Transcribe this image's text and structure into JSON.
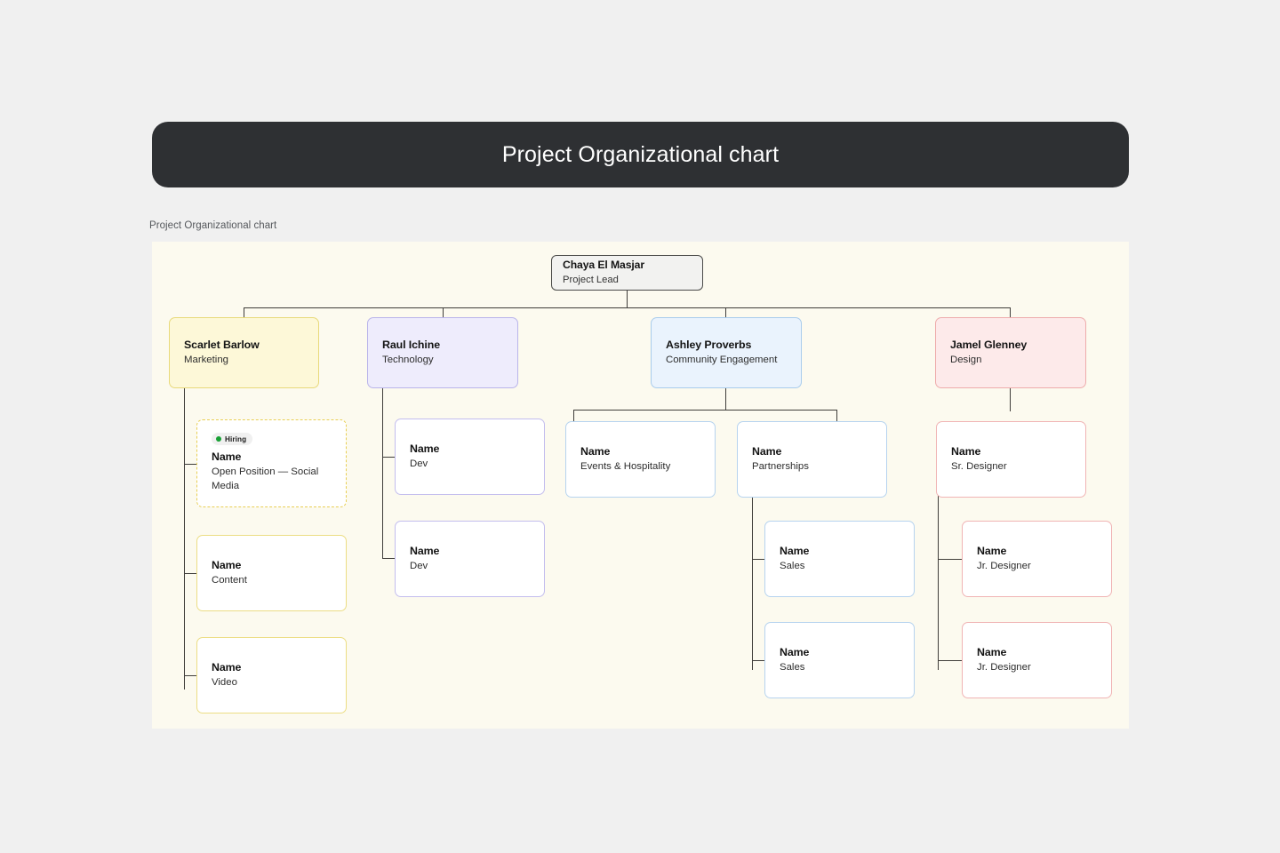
{
  "banner": {
    "title": "Project Organizational chart"
  },
  "caption": "Project Organizational chart",
  "colors": {
    "page_bg": "#f0f0f0",
    "banner_bg": "#2e3033",
    "canvas_bg": "#fcfaef",
    "connector": "#3f3d3a",
    "marketing": "#e8d97a",
    "technology": "#b9b4ea",
    "community": "#a9ccec",
    "design": "#eeacac",
    "hiring_dot": "#17a034"
  },
  "chart_data": {
    "type": "diagram",
    "title": "Project Organizational chart",
    "root": {
      "name": "Chaya El Masjar",
      "role": "Project Lead"
    },
    "departments": [
      {
        "name": "Scarlet Barlow",
        "role": "Marketing",
        "accent": "#e8d97a",
        "reports": [
          {
            "name": "Name",
            "role": "Open Position — Social Media",
            "badge": "Hiring",
            "status": "hiring"
          },
          {
            "name": "Name",
            "role": "Content"
          },
          {
            "name": "Name",
            "role": "Video"
          }
        ]
      },
      {
        "name": "Raul Ichine",
        "role": "Technology",
        "accent": "#b9b4ea",
        "reports": [
          {
            "name": "Name",
            "role": "Dev"
          },
          {
            "name": "Name",
            "role": "Dev"
          }
        ]
      },
      {
        "name": "Ashley Proverbs",
        "role": "Community Engagement",
        "accent": "#a9ccec",
        "reports": [
          {
            "name": "Name",
            "role": "Events & Hospitality"
          },
          {
            "name": "Name",
            "role": "Partnerships",
            "reports": [
              {
                "name": "Name",
                "role": "Sales"
              },
              {
                "name": "Name",
                "role": "Sales"
              }
            ]
          }
        ]
      },
      {
        "name": "Jamel Glenney",
        "role": "Design",
        "accent": "#eeacac",
        "reports": [
          {
            "name": "Name",
            "role": "Sr. Designer",
            "reports": [
              {
                "name": "Name",
                "role": "Jr. Designer"
              },
              {
                "name": "Name",
                "role": "Jr. Designer"
              }
            ]
          }
        ]
      }
    ]
  },
  "nodes": {
    "root": {
      "name": "Chaya El Masjar",
      "role": "Project Lead"
    },
    "marketing": {
      "name": "Scarlet Barlow",
      "role": "Marketing"
    },
    "technology": {
      "name": "Raul Ichine",
      "role": "Technology"
    },
    "community": {
      "name": "Ashley Proverbs",
      "role": "Community Engagement"
    },
    "design": {
      "name": "Jamel Glenney",
      "role": "Design"
    },
    "mk_hiring": {
      "name": "Name",
      "role": "Open Position — Social Media",
      "badge": "Hiring"
    },
    "mk_content": {
      "name": "Name",
      "role": "Content"
    },
    "mk_video": {
      "name": "Name",
      "role": "Video"
    },
    "tc_dev1": {
      "name": "Name",
      "role": "Dev"
    },
    "tc_dev2": {
      "name": "Name",
      "role": "Dev"
    },
    "cm_events": {
      "name": "Name",
      "role": "Events & Hospitality"
    },
    "cm_partner": {
      "name": "Name",
      "role": "Partnerships"
    },
    "cm_sales1": {
      "name": "Name",
      "role": "Sales"
    },
    "cm_sales2": {
      "name": "Name",
      "role": "Sales"
    },
    "ds_senior": {
      "name": "Name",
      "role": "Sr. Designer"
    },
    "ds_junior1": {
      "name": "Name",
      "role": "Jr. Designer"
    },
    "ds_junior2": {
      "name": "Name",
      "role": "Jr. Designer"
    }
  }
}
